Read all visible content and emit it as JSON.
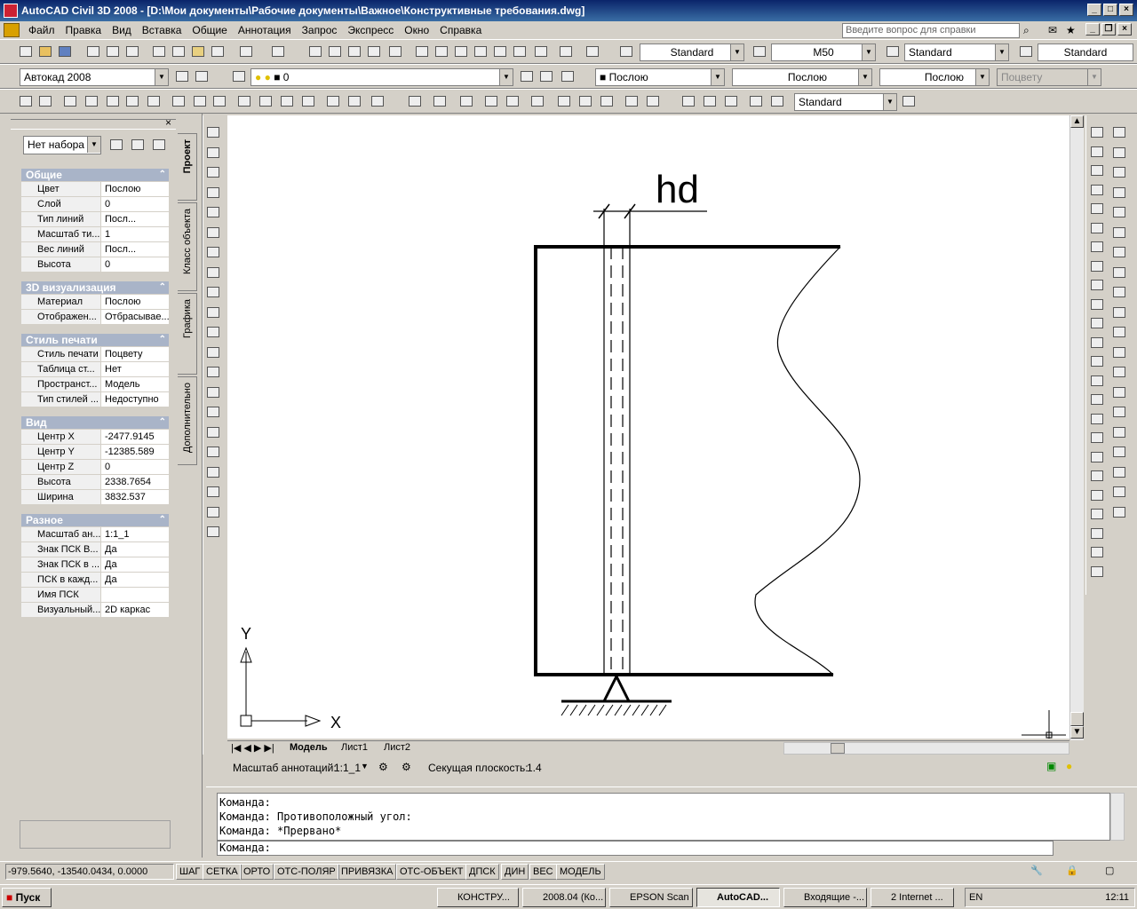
{
  "window": {
    "title": "AutoCAD Civil 3D 2008 - [D:\\Мои документы\\Рабочие документы\\Важное\\Конструктивные требования.dwg]"
  },
  "menu": [
    "Файл",
    "Правка",
    "Вид",
    "Вставка",
    "Общие",
    "Аннотация",
    "Запрос",
    "Экспресс",
    "Окно",
    "Справка"
  ],
  "help_search": {
    "placeholder": "Введите вопрос для справки"
  },
  "toolbar1": {
    "text_style": "Standard",
    "dim_style": "M50",
    "table_style": "Standard",
    "mleader_style": "Standard"
  },
  "toolbar2": {
    "workspace": "Автокад 2008",
    "layer": "0",
    "color": "Послою",
    "linetype": "Послою",
    "lineweight": "Послою",
    "plotstyle": "Поцвету"
  },
  "toolbar3": {
    "dim_style": "Standard"
  },
  "palette": {
    "selection": "Нет набора",
    "tabs": [
      "Проект",
      "Класс объекта",
      "Графика",
      "Дополнительно"
    ],
    "sections": [
      {
        "title": "Общие",
        "rows": [
          [
            "Цвет",
            "Послою"
          ],
          [
            "Слой",
            "0"
          ],
          [
            "Тип линий",
            "Посл..."
          ],
          [
            "Масштаб ти...",
            "1"
          ],
          [
            "Вес линий",
            "Посл..."
          ],
          [
            "Высота",
            "0"
          ]
        ]
      },
      {
        "title": "3D визуализация",
        "rows": [
          [
            "Материал",
            "Послою"
          ],
          [
            "Отображен...",
            "Отбрасывае..."
          ]
        ]
      },
      {
        "title": "Стиль печати",
        "rows": [
          [
            "Стиль печати",
            "Поцвету"
          ],
          [
            "Таблица ст...",
            "Нет"
          ],
          [
            "Пространст...",
            "Модель"
          ],
          [
            "Тип стилей ...",
            "Недоступно"
          ]
        ]
      },
      {
        "title": "Вид",
        "rows": [
          [
            "Центр X",
            "-2477.9145"
          ],
          [
            "Центр Y",
            "-12385.589"
          ],
          [
            "Центр Z",
            "0"
          ],
          [
            "Высота",
            "2338.7654"
          ],
          [
            "Ширина",
            "3832.537"
          ]
        ]
      },
      {
        "title": "Разное",
        "rows": [
          [
            "Масштаб ан...",
            "1:1_1"
          ],
          [
            "Знак ПСК В...",
            "Да"
          ],
          [
            "Знак ПСК в ...",
            "Да"
          ],
          [
            "ПСК в кажд...",
            "Да"
          ],
          [
            "Имя ПСК",
            ""
          ],
          [
            "Визуальный...",
            "2D каркас"
          ]
        ]
      }
    ]
  },
  "drawing": {
    "dim_label": "hd",
    "ucs_x": "X",
    "ucs_y": "Y"
  },
  "layout_tabs": [
    "Модель",
    "Лист1",
    "Лист2"
  ],
  "anno": {
    "scale_label": "Масштаб аннотаций:",
    "scale_value": "1:1_1",
    "section_label": "Секущая плоскость:",
    "section_value": "1.4"
  },
  "command": {
    "lines": [
      "Команда:",
      "Команда: Противоположный угол:",
      "Команда: *Прервано*"
    ],
    "prompt": "Команда:"
  },
  "status": {
    "coords": "-979.5640, -13540.0434, 0.0000",
    "buttons": [
      "ШАГ",
      "СЕТКА",
      "ОРТО",
      "ОТС-ПОЛЯР",
      "ПРИВЯЗКА",
      "ОТС-ОБЪЕКТ",
      "ДПСК",
      "ДИН",
      "ВЕС",
      "МОДЕЛЬ"
    ]
  },
  "taskbar": {
    "start": "Пуск",
    "tasks": [
      "КОНСТРУ...",
      "2008.04 (Ко...",
      "EPSON Scan",
      "AutoCAD...",
      "Входящие -...",
      "2 Internet ..."
    ],
    "lang": "EN",
    "clock": "12:11"
  }
}
